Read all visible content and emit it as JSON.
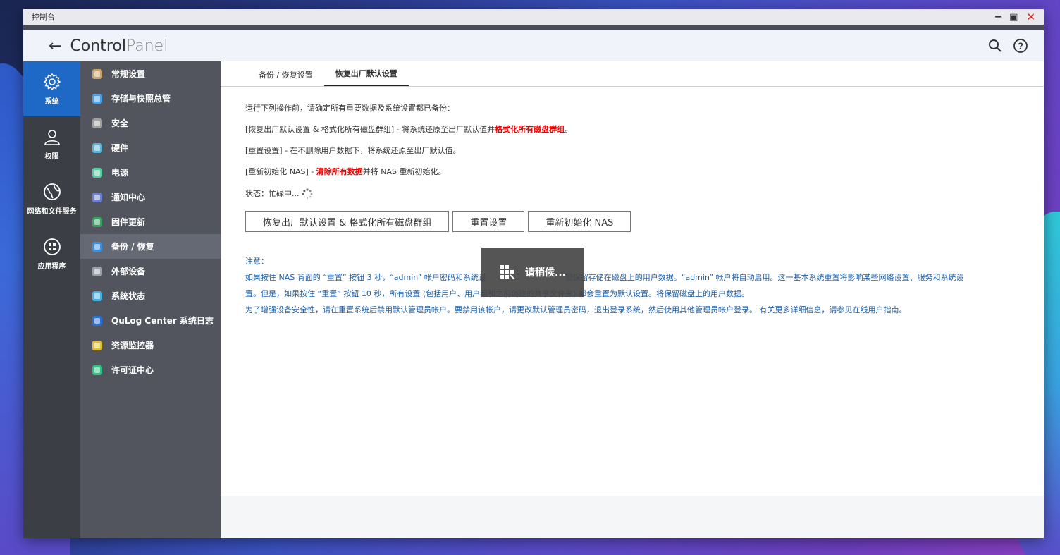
{
  "window": {
    "title": "控制台"
  },
  "header": {
    "brand_part1": "Control",
    "brand_part2": "Panel"
  },
  "rail": [
    {
      "label": "系统",
      "icon": "gear-icon",
      "active": true
    },
    {
      "label": "权限",
      "icon": "user-icon",
      "active": false
    },
    {
      "label": "网络和文件服务",
      "icon": "globe-icon",
      "active": false
    },
    {
      "label": "应用程序",
      "icon": "apps-icon",
      "active": false
    }
  ],
  "sidebar": [
    {
      "label": "常规设置",
      "icon": "general-settings-icon",
      "color": "#c9a26b"
    },
    {
      "label": "存储与快照总管",
      "icon": "storage-icon",
      "color": "#4aa0e6"
    },
    {
      "label": "安全",
      "icon": "lock-icon",
      "color": "#a0a0a0"
    },
    {
      "label": "硬件",
      "icon": "hardware-icon",
      "color": "#5ab0d0"
    },
    {
      "label": "电源",
      "icon": "power-icon",
      "color": "#5acaa0"
    },
    {
      "label": "通知中心",
      "icon": "notification-icon",
      "color": "#6a7fd0"
    },
    {
      "label": "固件更新",
      "icon": "firmware-icon",
      "color": "#3aa060"
    },
    {
      "label": "备份 / 恢复",
      "icon": "backup-icon",
      "color": "#3a8fe0",
      "active": true
    },
    {
      "label": "外部设备",
      "icon": "external-device-icon",
      "color": "#9aa0a8"
    },
    {
      "label": "系统状态",
      "icon": "monitor-icon",
      "color": "#4ab0e0"
    },
    {
      "label": "QuLog Center 系统日志",
      "icon": "qulog-icon",
      "color": "#2a70d0"
    },
    {
      "label": "资源监控器",
      "icon": "resource-monitor-icon",
      "color": "#e0c030"
    },
    {
      "label": "许可证中心",
      "icon": "license-icon",
      "color": "#30c080"
    }
  ],
  "tabs": [
    {
      "label": "备份 / 恢复设置",
      "active": false
    },
    {
      "label": "恢复出厂默认设置",
      "active": true
    }
  ],
  "content": {
    "intro": "运行下列操作前，请确定所有重要数据及系统设置都已备份：",
    "line1_a": "[恢复出厂默认设置 & 格式化所有磁盘群组] - 将系统还原至出厂默认值并",
    "line1_red": "格式化所有磁盘群组",
    "line1_b": "。",
    "line2": "[重置设置] - 在不删除用户数据下，将系统还原至出厂默认值。",
    "line3_a": "[重新初始化 NAS] - ",
    "line3_red": "清除所有数据",
    "line3_b": "并将 NAS 重新初始化。",
    "status_label": "状态：",
    "status_value": "忙碌中...",
    "buttons": {
      "factory_reset": "恢复出厂默认设置 & 格式化所有磁盘群组",
      "reset_settings": "重置设置",
      "reinit_nas": "重新初始化 NAS"
    },
    "note_title": "注意：",
    "note1": "如果按住 NAS 背面的 “重置” 按钮 3 秒，“admin” 帐户密码和系统设                                但保留存储在磁盘上的用户数据。“admin” 帐户将自动启用。这一基本系统重置将影响某些网络设置、服务和系统设",
    "note2": "置。但是，如果按住 “重置” 按钮 10 秒，所有设置 (包括用户、用户组和之前创建的共享文件夹) 都会重置为默认设置。将保留磁盘上的用户数据。",
    "note3": "为了增强设备安全性，请在重置系统后禁用默认管理员帐户。要禁用该帐户，请更改默认管理员密码，退出登录系统，然后使用其他管理员帐户登录。 有关更多详细信息，请参见在线用户指南。"
  },
  "overlay": {
    "text": "请稍候..."
  }
}
